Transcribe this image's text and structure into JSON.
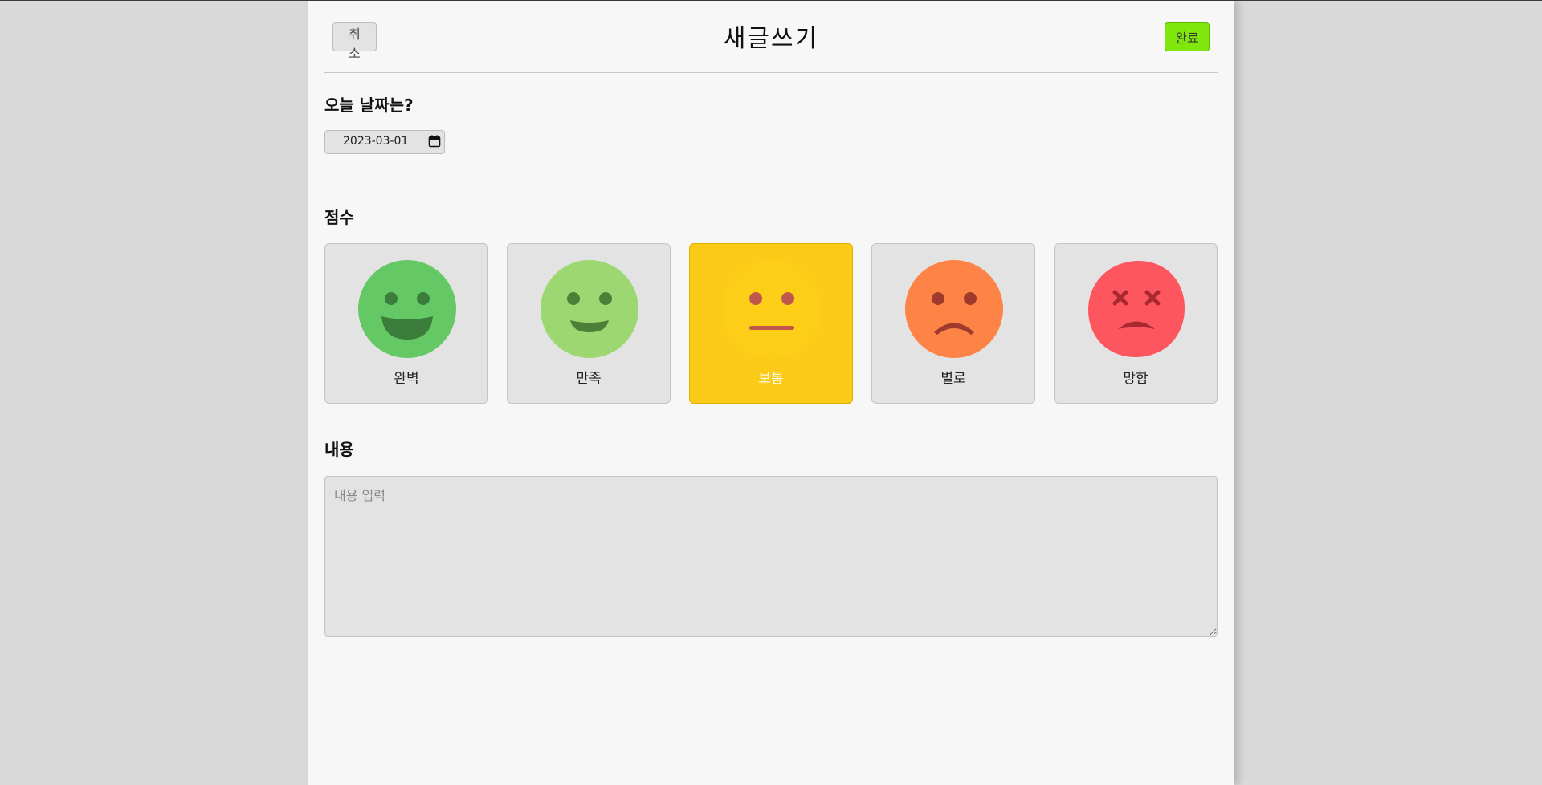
{
  "header": {
    "title": "새글쓰기",
    "cancel_label": "취소",
    "done_label": "완료"
  },
  "date_section": {
    "title": "오늘 날짜는?",
    "value": "2023-03-01"
  },
  "score_section": {
    "title": "점수",
    "emotions": [
      {
        "label": "완벽",
        "color": "#64c964",
        "selected": false
      },
      {
        "label": "만족",
        "color": "#9dd772",
        "selected": false
      },
      {
        "label": "보통",
        "color": "#fdce17",
        "selected": true
      },
      {
        "label": "별로",
        "color": "#fd8446",
        "selected": false
      },
      {
        "label": "망함",
        "color": "#fd565f",
        "selected": false
      }
    ]
  },
  "content_section": {
    "title": "내용",
    "placeholder": "내용 입력",
    "value": ""
  },
  "colors": {
    "done_button": "#80e80c",
    "selected_card": "#fccb18"
  }
}
